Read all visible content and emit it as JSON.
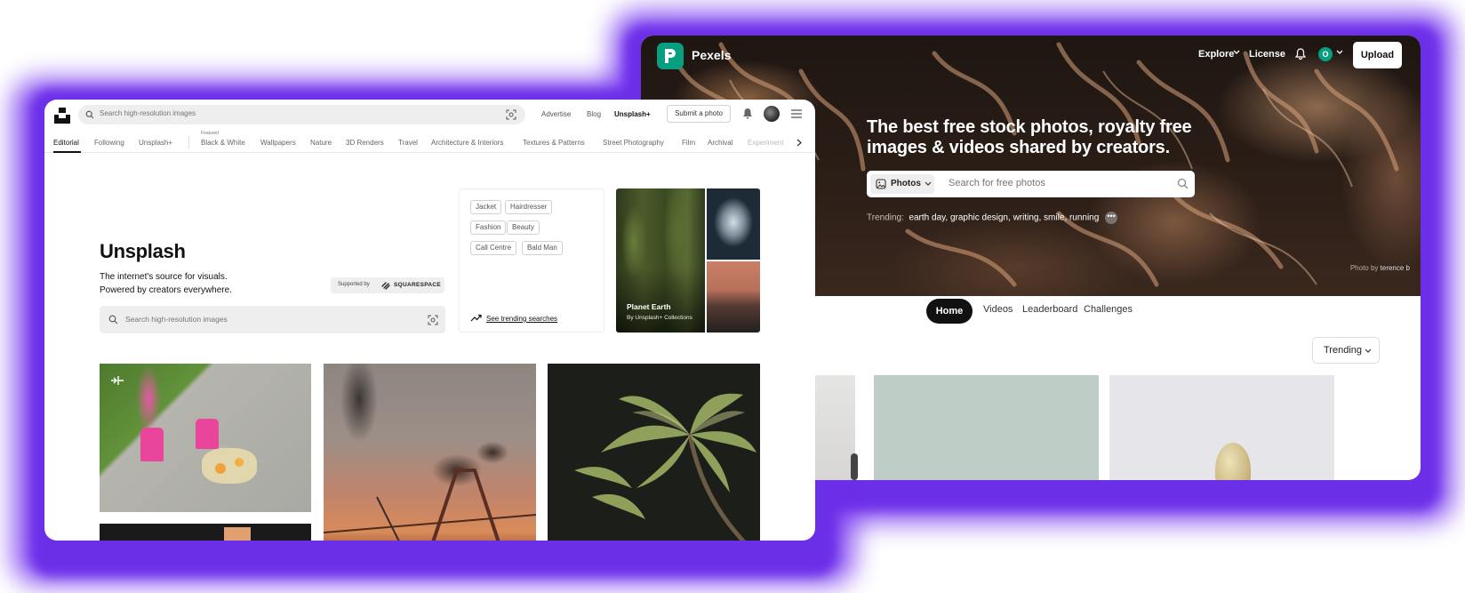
{
  "pexels": {
    "brand": "Pexels",
    "nav": {
      "explore": "Explore",
      "license": "License",
      "avatar_initial": "O",
      "upload": "Upload"
    },
    "headline": "The best free stock photos, royalty free images & videos shared by creators.",
    "search": {
      "type_label": "Photos",
      "placeholder": "Search for free photos"
    },
    "trending": {
      "label": "Trending:",
      "items": [
        "earth day,",
        "graphic design,",
        "writing,",
        "smile,",
        "running"
      ],
      "more": "•••"
    },
    "credit": {
      "prefix": "Photo by",
      "author": "terence b"
    },
    "tabs": [
      "Home",
      "Videos",
      "Leaderboard",
      "Challenges"
    ],
    "sort": "Trending",
    "accent": "#06a081"
  },
  "unsplash": {
    "search_placeholder": "Search high-resolution images",
    "top_nav": {
      "advertise": "Advertise",
      "blog": "Blog",
      "plus": "Unsplash+",
      "submit": "Submit a photo"
    },
    "categories": [
      "Editorial",
      "Following",
      "Unsplash+",
      "Black & White",
      "Wallpapers",
      "Nature",
      "3D Renders",
      "Travel",
      "Architecture & Interiors",
      "Textures & Patterns",
      "Street Photography",
      "Film",
      "Archival",
      "Experimental"
    ],
    "featured_label": "Featured",
    "title": "Unsplash",
    "subtitle_1": "The internet's source for visuals.",
    "subtitle_2": "Powered by creators everywhere.",
    "supported_by": "Supported by",
    "sponsor": "SQUARESPACE",
    "hero_search_placeholder": "Search high-resolution images",
    "trending_chips": [
      "Jacket",
      "Hairdresser",
      "Fashion",
      "Beauty",
      "Call Centre",
      "Bald Man"
    ],
    "see_trending": "See trending searches",
    "collection": {
      "title": "Planet Earth",
      "subtitle": "By Unsplash+ Collections"
    },
    "glow_color": "#7b3df0"
  }
}
